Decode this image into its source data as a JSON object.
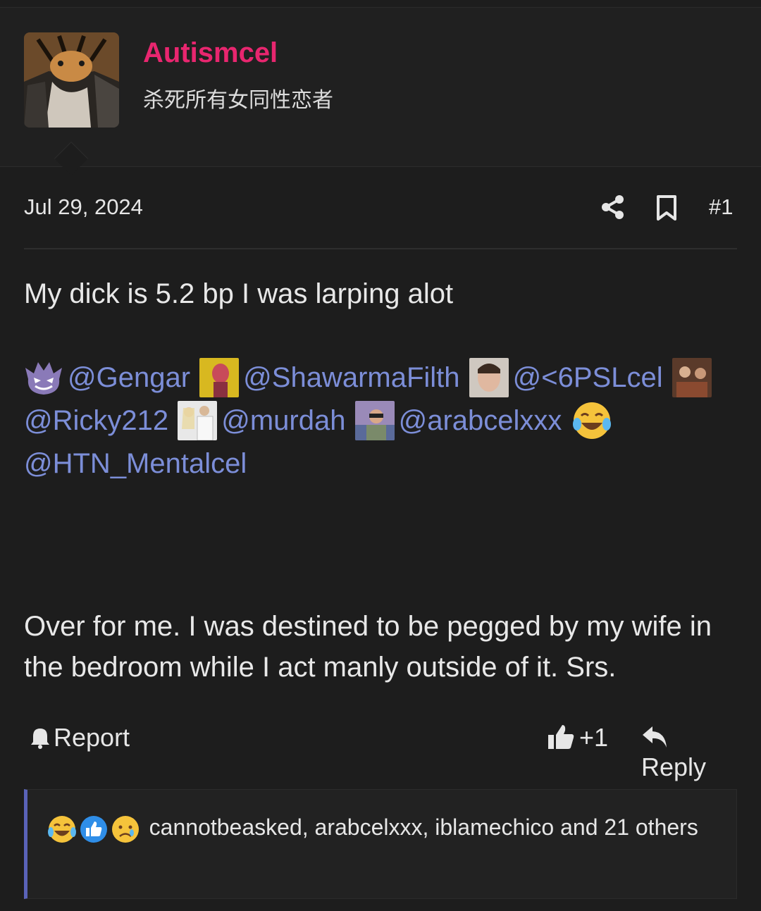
{
  "user": {
    "name": "Autismcel",
    "title": "杀死所有女同性恋者"
  },
  "post": {
    "date": "Jul 29, 2024",
    "number": "#1",
    "line1": "My dick is 5.2 bp I was larping alot",
    "mentions": [
      "@Gengar",
      "@ShawarmaFilth",
      "@<6PSLcel",
      "@Ricky212",
      "@murdah",
      "@arabcelxxx",
      "@HTN_Mentalcel"
    ],
    "line2": "Over for me. I was destined to be pegged by my wife in the bedroom while I act manly outside of it. Srs."
  },
  "actions": {
    "report": "Report",
    "like": "+1",
    "reply": "Reply"
  },
  "reactions": {
    "text": "cannotbeasked, arabcelxxx, iblamechico and 21 others"
  },
  "colors": {
    "accent": "#e8266f",
    "link": "#7c8ed8",
    "quote_bar": "#5a63b8"
  }
}
